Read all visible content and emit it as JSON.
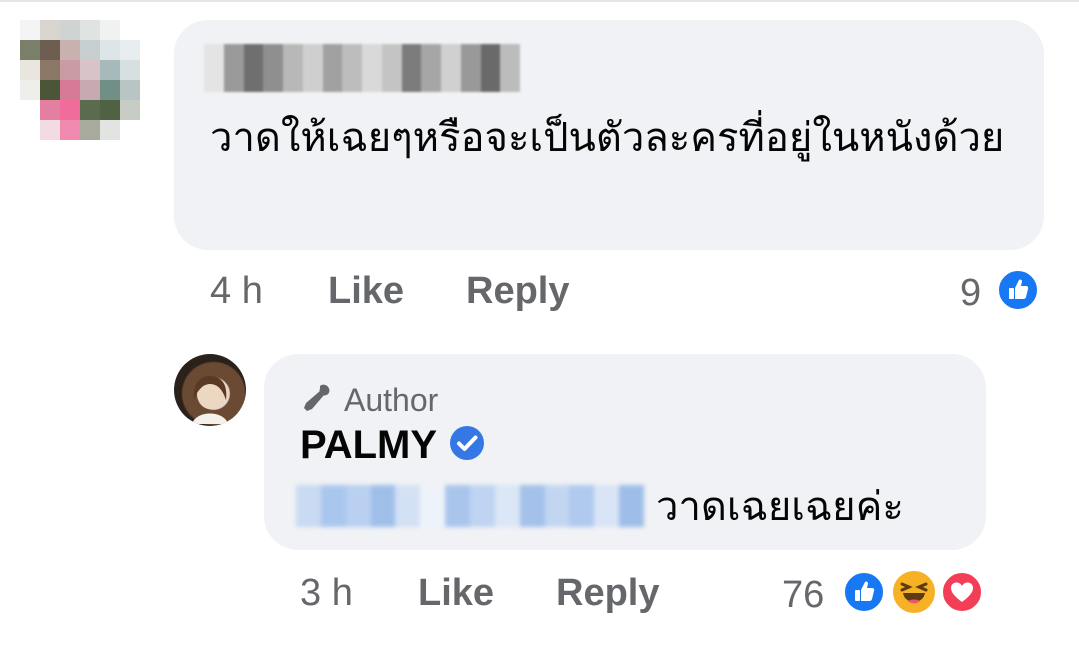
{
  "comment": {
    "text": "วาดให้เฉยๆหรือจะเป็นตัวละครที่อยู่ในหนังด้วย",
    "time": "4 h",
    "like_label": "Like",
    "reply_label": "Reply",
    "reaction_count": "9",
    "reactions": [
      "like-icon"
    ]
  },
  "reply": {
    "author_label": "Author",
    "author_name": "PALMY",
    "text": "วาดเฉยเฉยค่ะ",
    "time": "3 h",
    "like_label": "Like",
    "reply_label": "Reply",
    "reaction_count": "76",
    "reactions": [
      "like-icon",
      "haha-icon",
      "love-icon"
    ]
  },
  "colors": {
    "bubble": "#f0f2f5",
    "meta_text": "#65676b",
    "like_blue": "#1877f2",
    "love_red": "#f33e58",
    "haha_yellow": "#f7b125",
    "verified_blue": "#3578e5",
    "tag_blue": "#a9c7ee"
  }
}
